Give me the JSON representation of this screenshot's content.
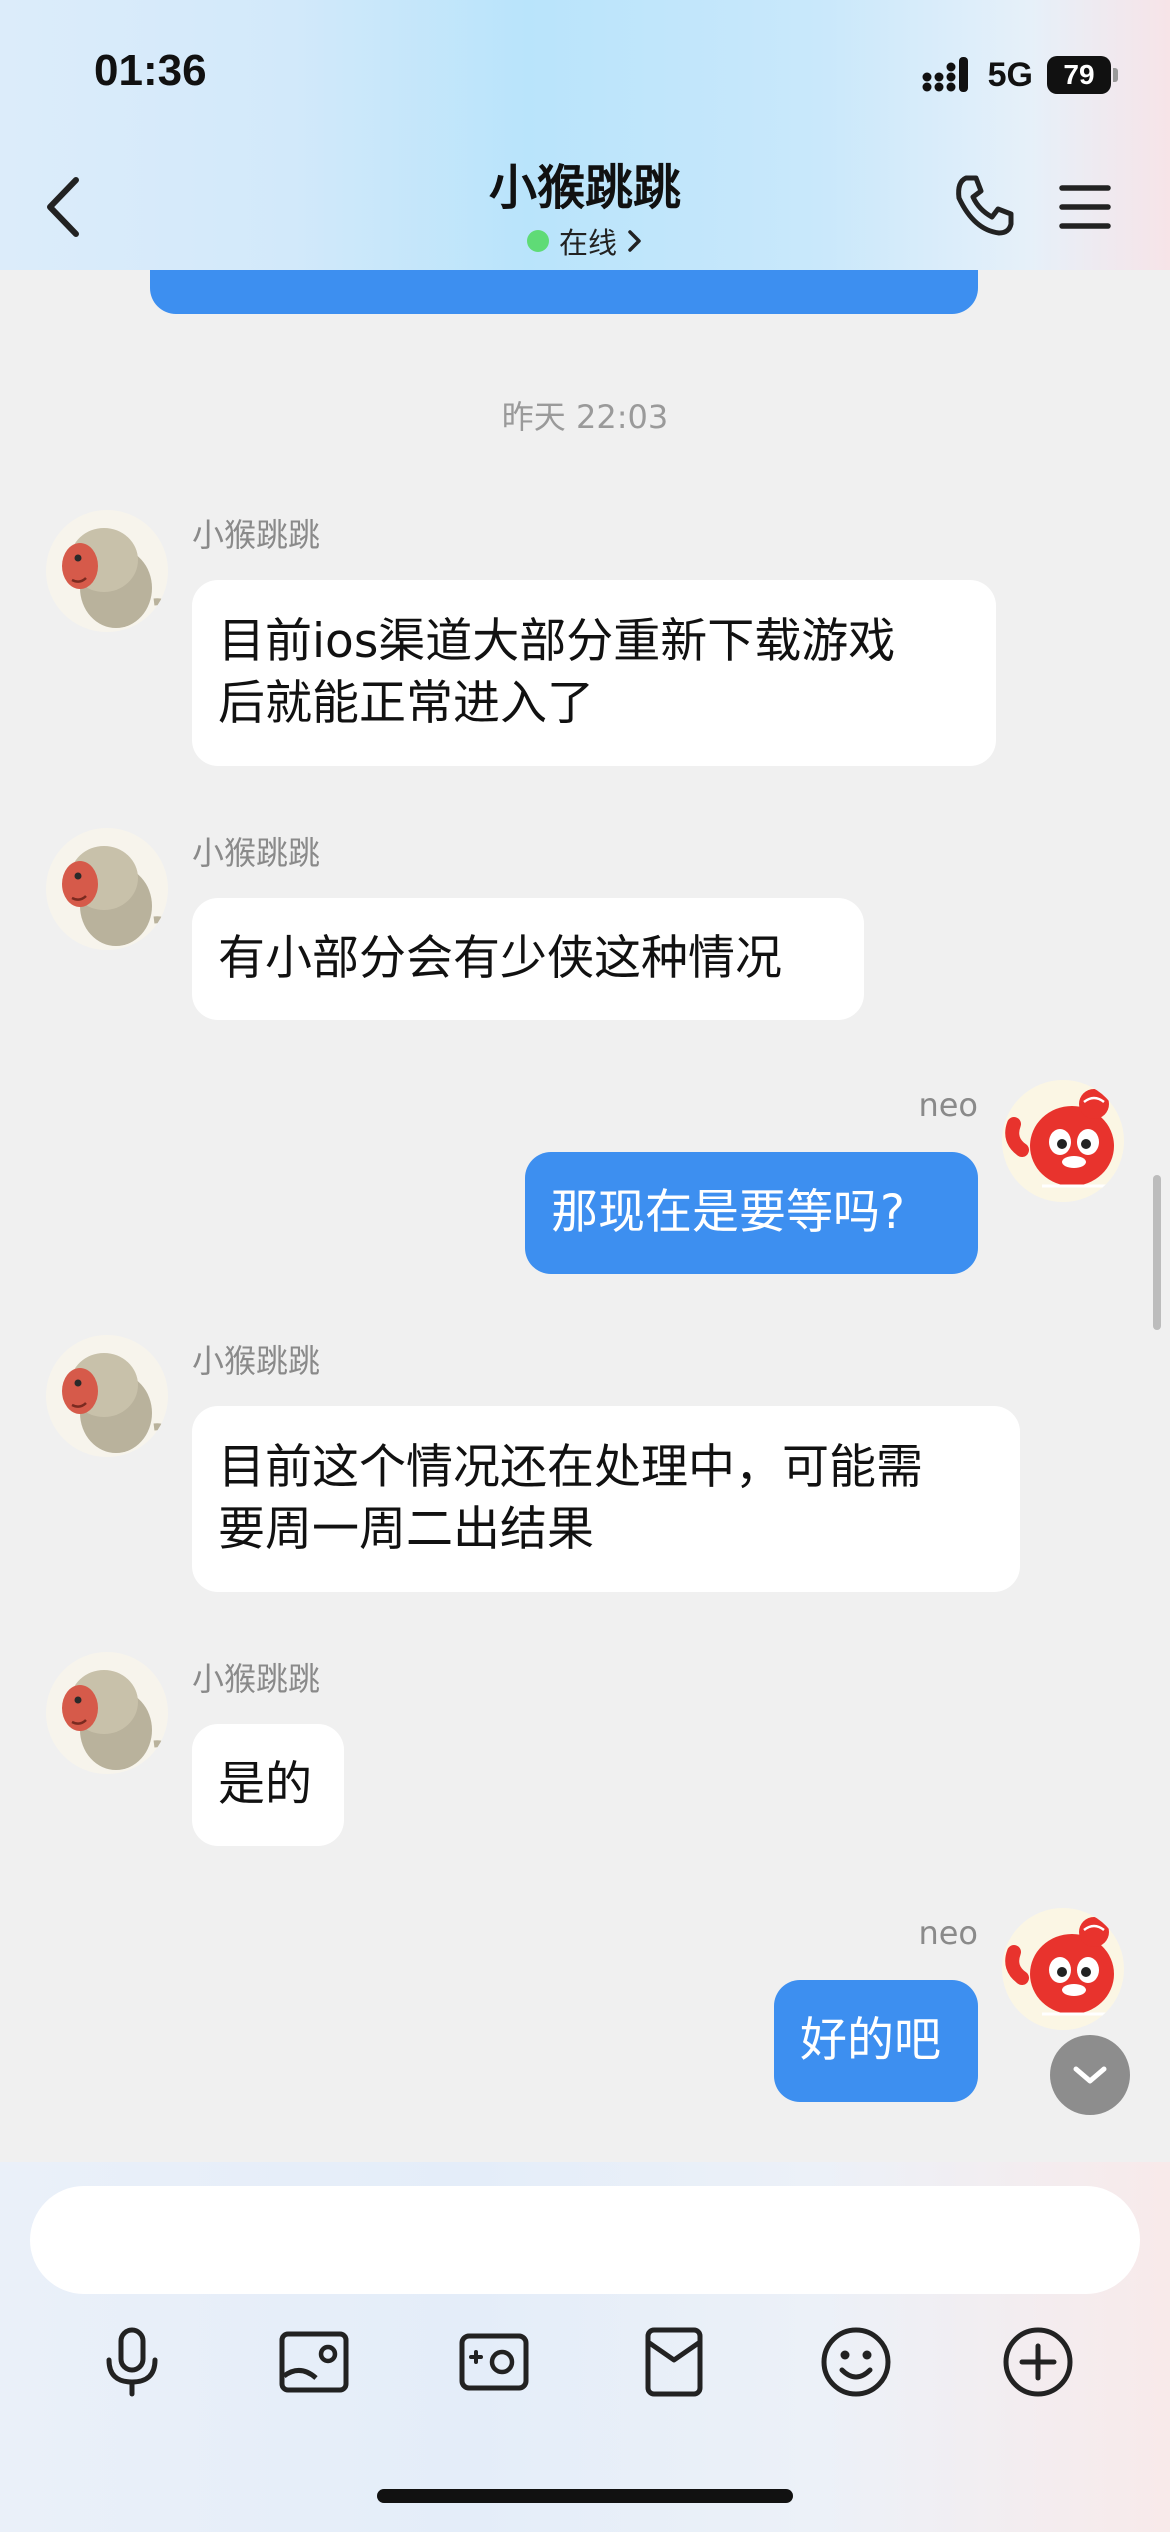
{
  "status_bar": {
    "time": "01:36",
    "network": "5G",
    "battery": "79"
  },
  "header": {
    "title": "小猴跳跳",
    "status": "在线"
  },
  "timestamp": "昨天 22:03",
  "messages": [
    {
      "side": "in",
      "sender": "小猴跳跳",
      "lines": [
        "目前ios渠道大部分重新下载游戏",
        "后就能正常进入了"
      ]
    },
    {
      "side": "in",
      "sender": "小猴跳跳",
      "lines": [
        "有小部分会有少侠这种情况"
      ]
    },
    {
      "side": "out",
      "sender": "neo",
      "lines": [
        "那现在是要等吗?"
      ]
    },
    {
      "side": "in",
      "sender": "小猴跳跳",
      "lines": [
        "目前这个情况还在处理中，可能需",
        "要周一周二出结果"
      ]
    },
    {
      "side": "in",
      "sender": "小猴跳跳",
      "lines": [
        "是的"
      ]
    },
    {
      "side": "out",
      "sender": "neo",
      "lines": [
        "好的吧"
      ]
    }
  ],
  "toolbar": [
    "microphone-icon",
    "photo-icon",
    "camera-icon",
    "red-packet-icon",
    "emoji-icon",
    "plus-icon"
  ],
  "colors": {
    "out_bubble": "#3d8ff0",
    "in_bubble": "#ffffff",
    "background": "#f0f0f0",
    "online": "#5fdb76"
  }
}
